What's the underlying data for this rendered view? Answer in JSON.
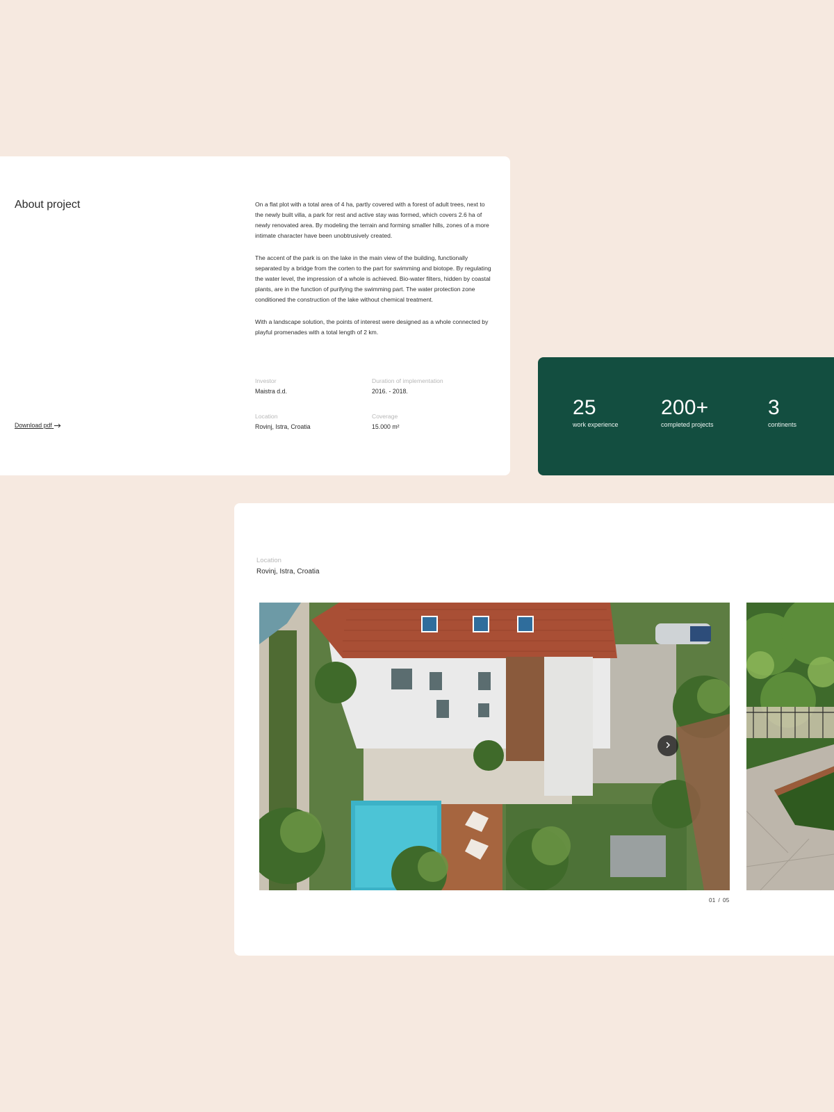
{
  "about": {
    "title": "About project",
    "paragraphs": [
      "On a flat plot with a total area of 4 ha, partly covered with a forest of adult trees, next to the newly built villa, a park for rest and active stay was formed, which covers 2.6 ha of newly renovated area. By modeling the terrain and forming smaller hills, zones of a more intimate character have been unobtrusively created.",
      "The accent of the park is on the lake in the main view of the building, functionally separated by a bridge from the corten to the part for swimming and biotope. By regulating the water level, the impression of a whole is achieved. Bio-water filters, hidden by coastal plants, are in the function of purifying the swimming part. The water protection zone conditioned the construction of the lake without chemical treatment.",
      "With a landscape solution, the points of interest were designed as a whole connected by playful promenades with a total length of 2 km."
    ],
    "meta": {
      "investor": {
        "label": "Investor",
        "value": "Maistra d.d."
      },
      "duration": {
        "label": "Duration of implementation",
        "value": "2016. - 2018."
      },
      "location": {
        "label": "Location",
        "value": "Rovinj, Istra, Croatia"
      },
      "coverage": {
        "label": "Coverage",
        "value": "15.000 m²"
      }
    },
    "download_label": "Download pdf",
    "download_icon": "arrow-right-icon"
  },
  "stats": [
    {
      "value": "25",
      "label": "work experience"
    },
    {
      "value": "200+",
      "label": "completed projects"
    },
    {
      "value": "3",
      "label": "continents"
    }
  ],
  "gallery": {
    "location_label": "Location",
    "location_value": "Rovinj, Istra, Croatia",
    "current": "01",
    "separator": "/",
    "total": "05",
    "next_icon": "chevron-right-icon",
    "main_image": "aerial-villa-pool-photo",
    "side_image": "garden-path-photo"
  },
  "colors": {
    "background": "#f6e9e0",
    "card": "#ffffff",
    "accent_green": "#134e40",
    "muted_label": "#b7b7b7"
  }
}
